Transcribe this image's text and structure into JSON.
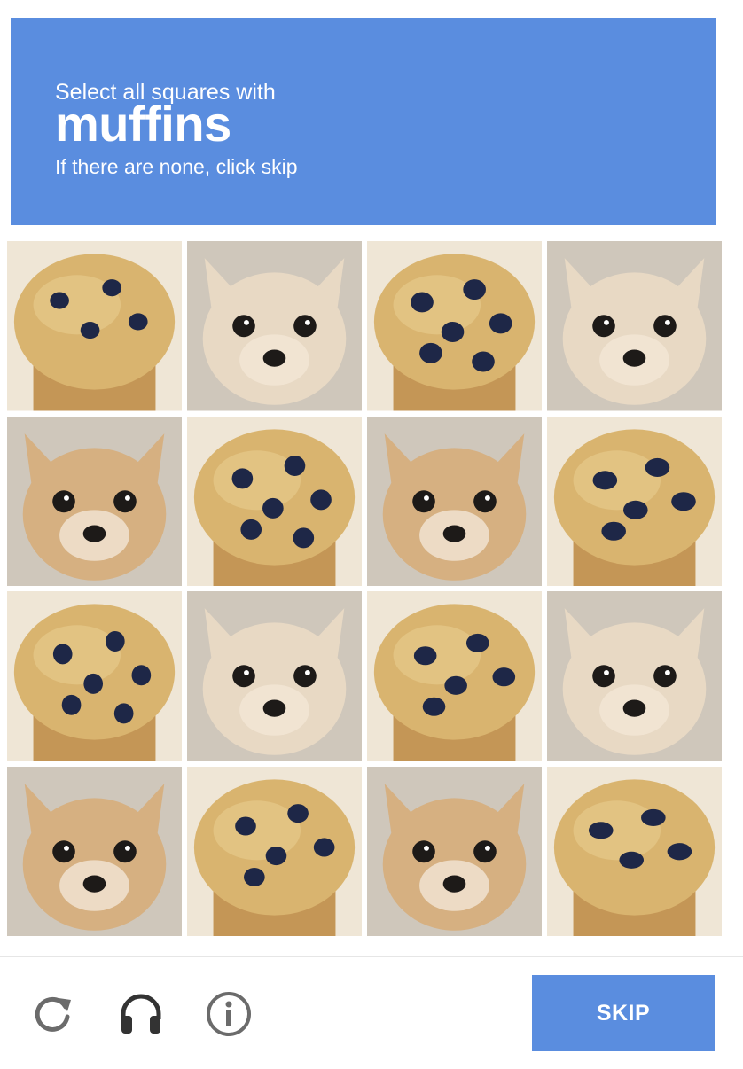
{
  "header": {
    "line1": "Select all squares with",
    "target": "muffins",
    "line3": "If there are none, click skip"
  },
  "colors": {
    "accent": "#5a8ddf",
    "muffin": "#d9b46f",
    "chihuahua": "#d6b081",
    "blueberry": "#1e2747"
  },
  "tiles": [
    {
      "content": "muffin"
    },
    {
      "content": "chihuahua"
    },
    {
      "content": "muffin"
    },
    {
      "content": "chihuahua"
    },
    {
      "content": "chihuahua"
    },
    {
      "content": "muffin"
    },
    {
      "content": "chihuahua"
    },
    {
      "content": "muffin"
    },
    {
      "content": "muffin"
    },
    {
      "content": "chihuahua"
    },
    {
      "content": "muffin"
    },
    {
      "content": "chihuahua"
    },
    {
      "content": "chihuahua"
    },
    {
      "content": "muffin"
    },
    {
      "content": "chihuahua"
    },
    {
      "content": "muffin"
    }
  ],
  "controls": {
    "reload_icon": "reload-icon",
    "audio_icon": "headphones-icon",
    "info_icon": "info-icon"
  },
  "skip_label": "SKIP"
}
